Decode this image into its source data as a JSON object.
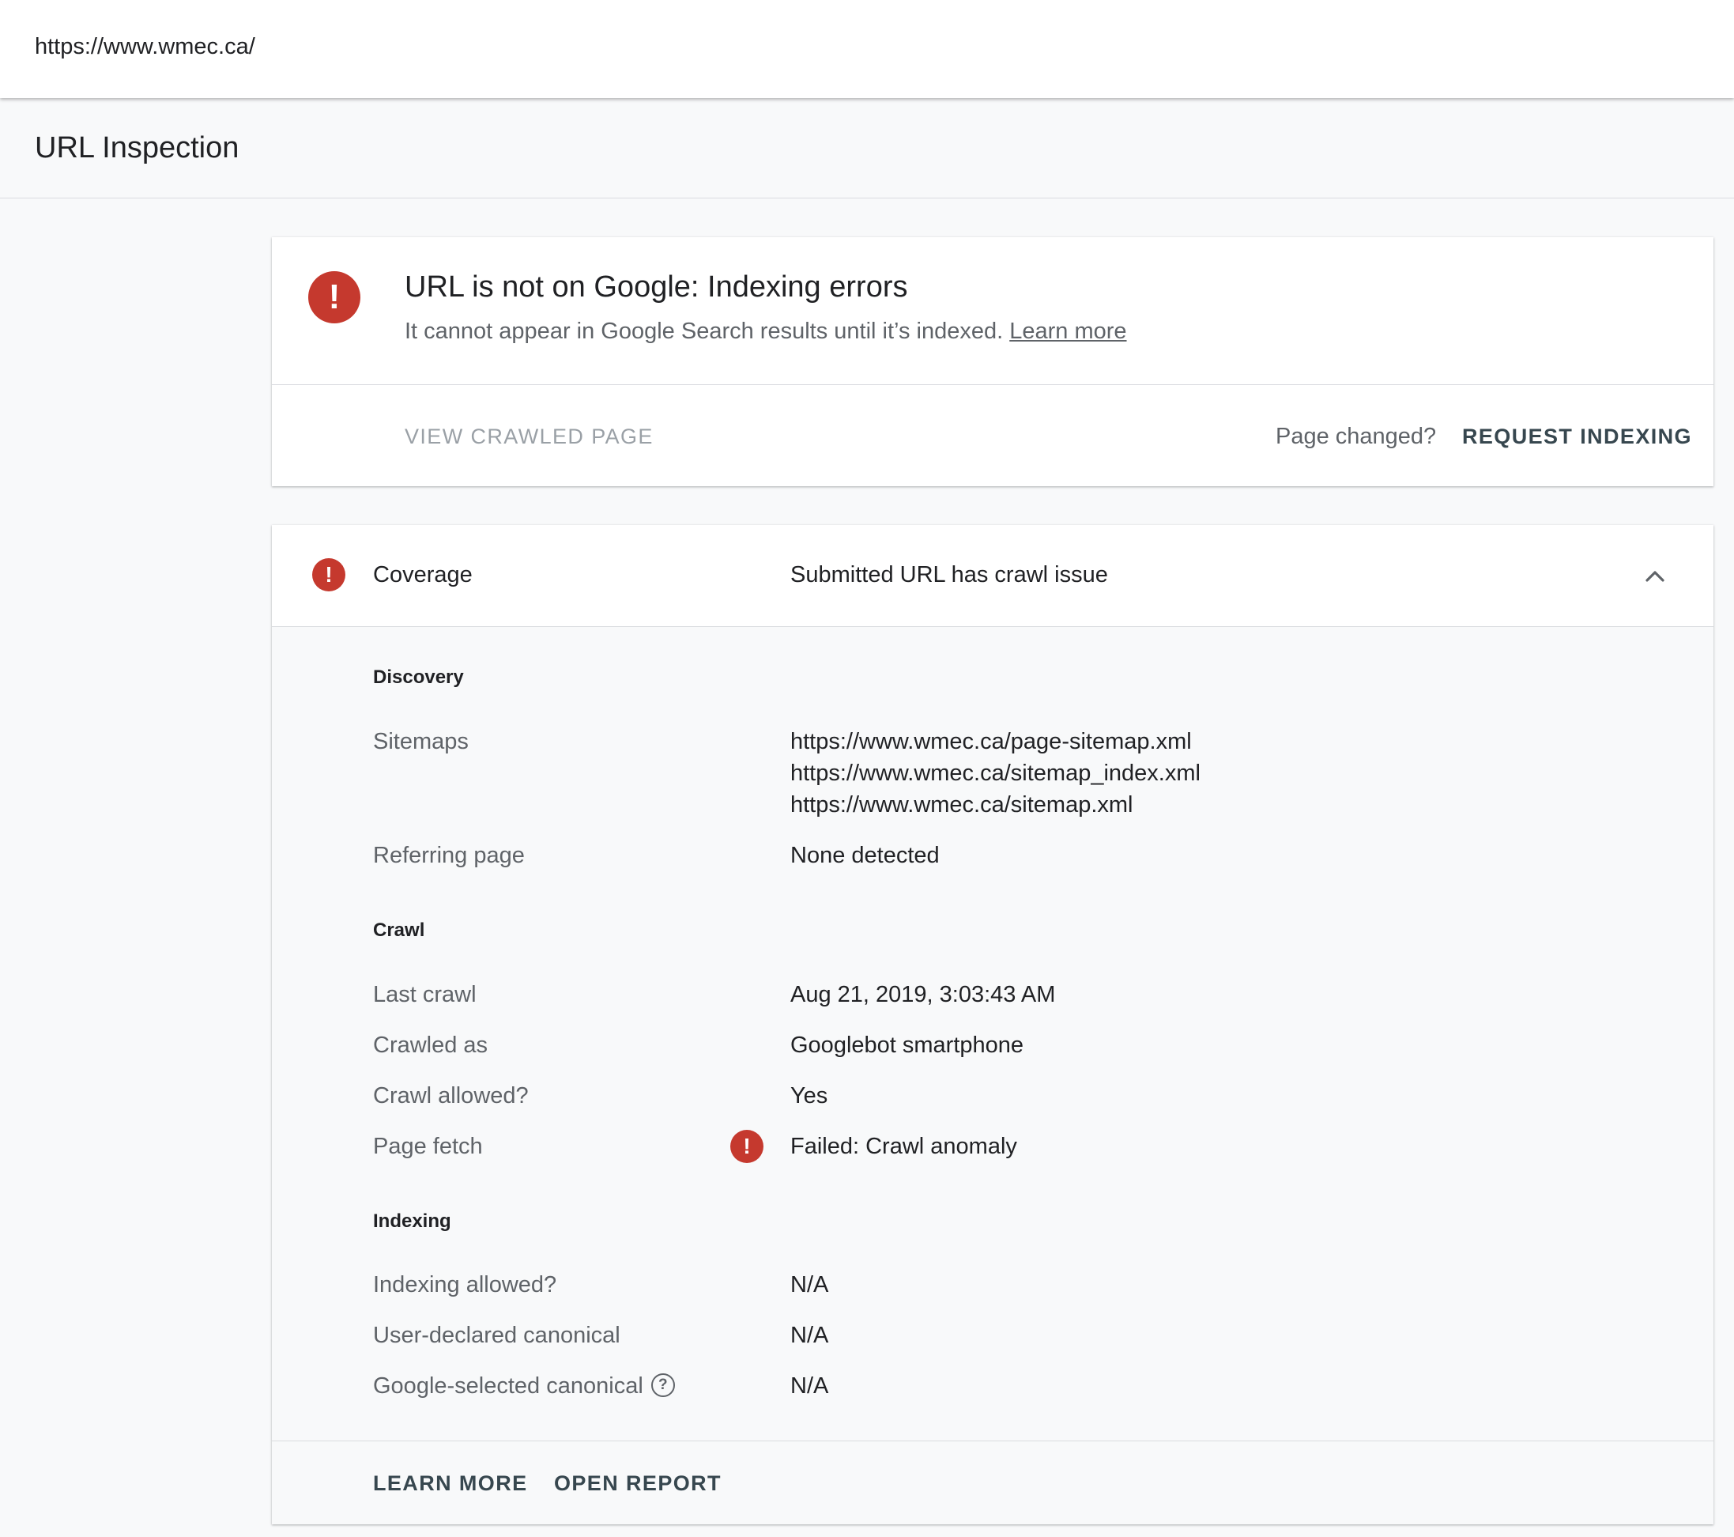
{
  "topbar": {
    "url": "https://www.wmec.ca/"
  },
  "page": {
    "title": "URL Inspection"
  },
  "status": {
    "icon": "error-icon",
    "title": "URL is not on Google: Indexing errors",
    "description": "It cannot appear in Google Search results until it’s indexed.",
    "learn_more_link": "Learn more",
    "view_crawled_label": "VIEW CRAWLED PAGE",
    "page_changed": "Page changed?",
    "request_indexing_label": "REQUEST INDEXING"
  },
  "coverage": {
    "icon": "error-icon",
    "label": "Coverage",
    "value": "Submitted URL has crawl issue",
    "expanded": true,
    "discovery": {
      "title": "Discovery",
      "sitemaps_label": "Sitemaps",
      "sitemaps": [
        "https://www.wmec.ca/page-sitemap.xml",
        "https://www.wmec.ca/sitemap_index.xml",
        "https://www.wmec.ca/sitemap.xml"
      ],
      "referring_label": "Referring page",
      "referring_value": "None detected"
    },
    "crawl": {
      "title": "Crawl",
      "rows": [
        {
          "label": "Last crawl",
          "value": "Aug 21, 2019, 3:03:43 AM"
        },
        {
          "label": "Crawled as",
          "value": "Googlebot smartphone"
        },
        {
          "label": "Crawl allowed?",
          "value": "Yes"
        },
        {
          "label": "Page fetch",
          "value": "Failed: Crawl anomaly",
          "status": "error"
        }
      ]
    },
    "indexing": {
      "title": "Indexing",
      "rows": [
        {
          "label": "Indexing allowed?",
          "value": "N/A"
        },
        {
          "label": "User-declared canonical",
          "value": "N/A"
        },
        {
          "label": "Google-selected canonical",
          "value": "N/A",
          "help_icon": "question-mark"
        }
      ]
    },
    "footer": {
      "learn_more": "LEARN MORE",
      "open_report": "OPEN REPORT"
    }
  },
  "colors": {
    "error": "#c5392e",
    "action": "#37474f",
    "muted": "#5f6368",
    "disabled": "#9aa0a6",
    "background": "#f8f9fa"
  }
}
